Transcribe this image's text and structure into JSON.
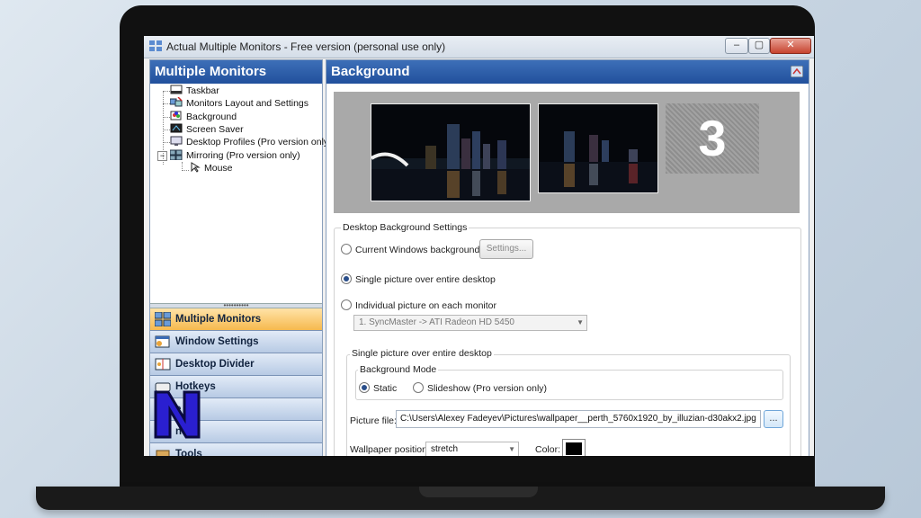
{
  "window": {
    "title": "Actual Multiple Monitors - Free version (personal use only)",
    "controls": {
      "minimize": "–",
      "maximize": "▢",
      "close": "✕"
    }
  },
  "left_panel": {
    "header": "Multiple Monitors",
    "tree": [
      {
        "label": "Taskbar",
        "icon": "taskbar-icon"
      },
      {
        "label": "Monitors Layout and Settings",
        "icon": "monitors-layout-icon"
      },
      {
        "label": "Background",
        "icon": "background-icon"
      },
      {
        "label": "Screen Saver",
        "icon": "screen-saver-icon"
      },
      {
        "label": "Desktop Profiles (Pro version only)",
        "icon": "desktop-profiles-icon"
      },
      {
        "label": "Mirroring (Pro version only)",
        "icon": "mirroring-icon"
      },
      {
        "label": "Mouse",
        "icon": "mouse-icon"
      }
    ],
    "splitter": "••••••••••",
    "nav": [
      {
        "label": "Multiple Monitors",
        "active": true
      },
      {
        "label": "Window Settings",
        "active": false
      },
      {
        "label": "Desktop Divider",
        "active": false
      },
      {
        "label": "Hotkeys",
        "active": false
      },
      {
        "label": "e",
        "active": false
      },
      {
        "label": "ns",
        "active": false
      },
      {
        "label": "Tools",
        "active": false
      }
    ]
  },
  "right_panel": {
    "header": "Background",
    "preview": {
      "monitor3_label": "3"
    },
    "desktop_settings": {
      "group_label": "Desktop Background Settings",
      "opt_current": "Current Windows background",
      "settings_button": "Settings...",
      "opt_single": "Single picture over entire desktop",
      "opt_individual": "Individual picture on each monitor",
      "monitor_select": "1. SyncMaster -> ATI Radeon HD 5450",
      "selected": "single"
    },
    "single_picture": {
      "group_label": "Single picture over entire desktop",
      "mode_group_label": "Background Mode",
      "mode_static": "Static",
      "mode_slideshow": "Slideshow (Pro version only)",
      "mode_selected": "static",
      "picture_file_label": "Picture file:",
      "picture_file_value": "C:\\Users\\Alexey Fadeyev\\Pictures\\wallpaper__perth_5760x1920_by_illuzian-d30akx2.jpg",
      "browse_label": "...",
      "position_label": "Wallpaper position:",
      "position_value": "stretch",
      "color_label": "Color:",
      "color_value": "#000000"
    }
  },
  "colors": {
    "header_blue": "#21509c",
    "active_nav": "#f6b94e",
    "logo": "#2a1fd0"
  }
}
